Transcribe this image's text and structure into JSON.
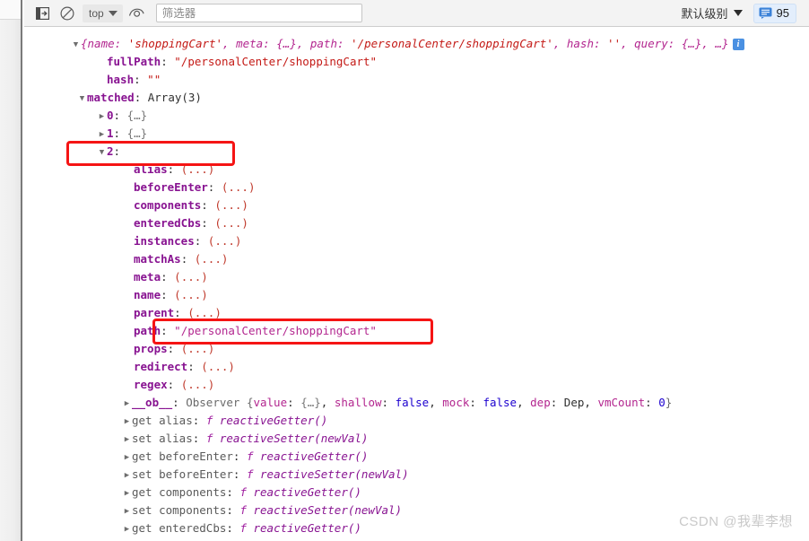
{
  "toolbar": {
    "sidebar_icon": "panel-toggle-icon",
    "clear_icon": "clear-console-icon",
    "context_label": "top",
    "eye_icon": "live-expression-eye-icon",
    "filter_placeholder": "筛选器",
    "level_label": "默认级别",
    "message_icon": "message-icon",
    "message_count": "95"
  },
  "console": {
    "preview": {
      "t1": "{name: ",
      "v1": "'shoppingCart'",
      "t2": ", meta: {…}, path: ",
      "v2": "'/personalCenter/shoppingCart'",
      "t3": ", hash: ",
      "v3": "''",
      "t4": ", query: {…}, …}",
      "info": "i"
    },
    "top_props": [
      {
        "key": "fullPath",
        "sep": ": ",
        "value": "\"/personalCenter/shoppingCart\"",
        "type": "string"
      },
      {
        "key": "hash",
        "sep": ": ",
        "value": "\"\"",
        "type": "string"
      }
    ],
    "matched": {
      "key": "matched",
      "sep": ": ",
      "value": "Array(3)",
      "items": [
        {
          "index": "0",
          "sep": ": ",
          "value": "{…}"
        },
        {
          "index": "1",
          "sep": ": ",
          "value": "{…}"
        },
        {
          "index": "2",
          "sep": ":",
          "value": ""
        }
      ]
    },
    "item2_props": [
      {
        "key": "alias",
        "sep": ": ",
        "value": "(...)"
      },
      {
        "key": "beforeEnter",
        "sep": ": ",
        "value": "(...)"
      },
      {
        "key": "components",
        "sep": ": ",
        "value": "(...)"
      },
      {
        "key": "enteredCbs",
        "sep": ": ",
        "value": "(...)"
      },
      {
        "key": "instances",
        "sep": ": ",
        "value": "(...)"
      },
      {
        "key": "matchAs",
        "sep": ": ",
        "value": "(...)"
      },
      {
        "key": "meta",
        "sep": ": ",
        "value": "(...)"
      },
      {
        "key": "name",
        "sep": ": ",
        "value": "(...)"
      },
      {
        "key": "parent",
        "sep": ": ",
        "value": "(...)"
      },
      {
        "key": "path",
        "sep": ": ",
        "value": "\"/personalCenter/shoppingCart\"",
        "highlight": true
      },
      {
        "key": "props",
        "sep": ": ",
        "value": "(...)"
      },
      {
        "key": "redirect",
        "sep": ": ",
        "value": "(...)"
      },
      {
        "key": "regex",
        "sep": ": ",
        "value": "(...)"
      }
    ],
    "observer": {
      "key": "__ob__",
      "sep": ": ",
      "ctor": "Observer ",
      "brace_open": "{",
      "fields": [
        {
          "name": "value",
          "sep": ": ",
          "value": "{…}",
          "vtype": "obj",
          "tail": ", "
        },
        {
          "name": "shallow",
          "sep": ": ",
          "value": "false",
          "vtype": "bool",
          "tail": ", "
        },
        {
          "name": "mock",
          "sep": ": ",
          "value": "false",
          "vtype": "bool",
          "tail": ", "
        },
        {
          "name": "dep",
          "sep": ": ",
          "value": "Dep",
          "vtype": "plain",
          "tail": ", "
        },
        {
          "name": "vmCount",
          "sep": ": ",
          "value": "0",
          "vtype": "num",
          "tail": ""
        }
      ],
      "brace_close": "}"
    },
    "accessors": [
      {
        "kind": "get ",
        "name": "alias",
        "sep": ": ",
        "fsym": "f ",
        "fn": "reactiveGetter()"
      },
      {
        "kind": "set ",
        "name": "alias",
        "sep": ": ",
        "fsym": "f ",
        "fn": "reactiveSetter(newVal)"
      },
      {
        "kind": "get ",
        "name": "beforeEnter",
        "sep": ": ",
        "fsym": "f ",
        "fn": "reactiveGetter()"
      },
      {
        "kind": "set ",
        "name": "beforeEnter",
        "sep": ": ",
        "fsym": "f ",
        "fn": "reactiveSetter(newVal)"
      },
      {
        "kind": "get ",
        "name": "components",
        "sep": ": ",
        "fsym": "f ",
        "fn": "reactiveGetter()"
      },
      {
        "kind": "set ",
        "name": "components",
        "sep": ": ",
        "fsym": "f ",
        "fn": "reactiveSetter(newVal)"
      },
      {
        "kind": "get ",
        "name": "enteredCbs",
        "sep": ": ",
        "fsym": "f ",
        "fn": "reactiveGetter()"
      }
    ]
  },
  "watermark": {
    "text": "CSDN @我辈李想"
  },
  "colors": {
    "annotation_red": "#f51414",
    "property_purple": "#881391",
    "string_red": "#c41a16",
    "value_blue": "#1c00cf",
    "badge_blue": "#4a90e2"
  }
}
